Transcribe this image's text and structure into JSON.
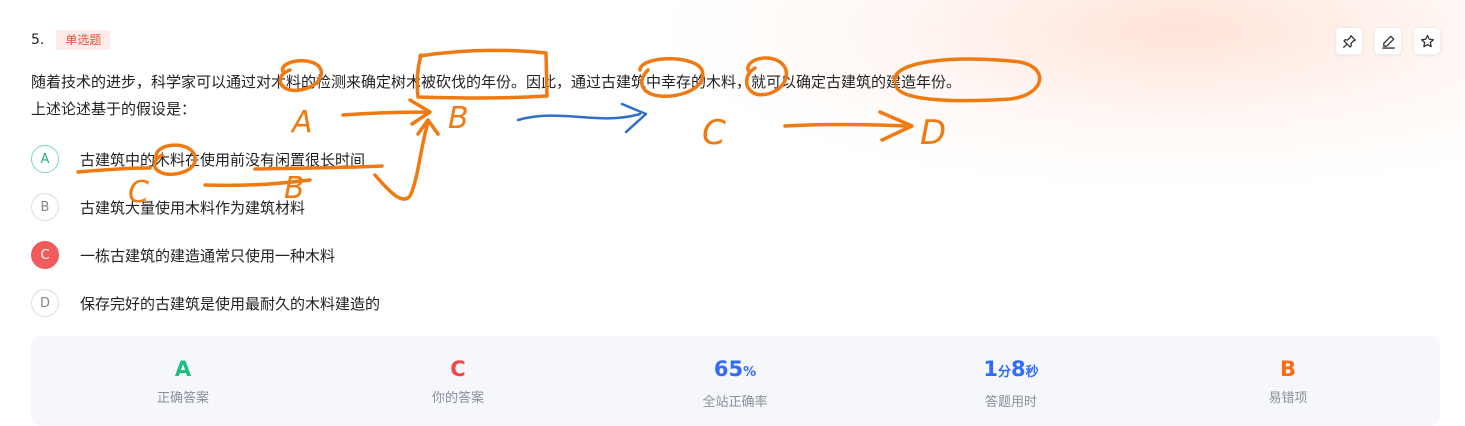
{
  "question": {
    "number": "5.",
    "type_badge": "单选题",
    "stem_line1": "随着技术的进步，科学家可以通过对木料的检测来确定树木被砍伐的年份。因此，通过古建筑中幸存的木料，就可以确定古建筑的建造年份。",
    "stem_line2": "上述论述基于的假设是："
  },
  "toolbar": {
    "icons": [
      "pin-icon",
      "edit-icon",
      "star-icon"
    ]
  },
  "options": [
    {
      "letter": "A",
      "text": "古建筑中的木料在使用前没有闲置很长时间",
      "state": "correct"
    },
    {
      "letter": "B",
      "text": "古建筑大量使用木料作为建筑材料",
      "state": "normal"
    },
    {
      "letter": "C",
      "text": "一栋古建筑的建造通常只使用一种木料",
      "state": "wrong"
    },
    {
      "letter": "D",
      "text": "保存完好的古建筑是使用最耐久的木料建造的",
      "state": "normal"
    }
  ],
  "stats": {
    "correct_answer": {
      "value": "A",
      "label": "正确答案",
      "color": "#1dbf7e"
    },
    "your_answer": {
      "value": "C",
      "label": "你的答案",
      "color": "#f04848"
    },
    "accuracy": {
      "value": "65",
      "unit": "%",
      "label": "全站正确率",
      "color": "#2f6bff"
    },
    "time": {
      "min": "1",
      "min_unit": "分",
      "sec": "8",
      "sec_unit": "秒",
      "label": "答题用时",
      "color": "#2f6bff"
    },
    "common_wrong": {
      "value": "B",
      "label": "易错项",
      "color": "#ff6a13"
    }
  },
  "annotations": {
    "colors": {
      "ink": "#f07a12",
      "arrow": "#2f6fc7"
    },
    "labels": [
      "A",
      "B",
      "C",
      "D",
      "C",
      "B"
    ]
  }
}
